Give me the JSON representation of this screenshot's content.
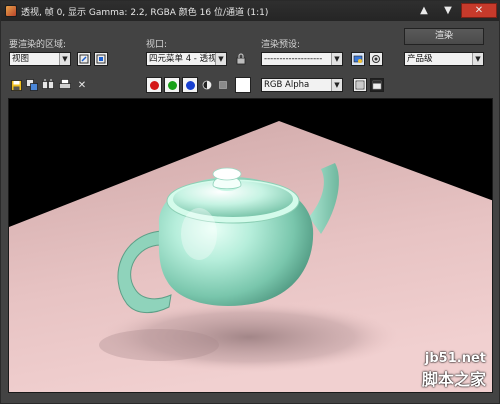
{
  "window": {
    "title": "透视, 帧 0, 显示 Gamma: 2.2, RGBA 颜色 16 位/通道 (1:1)",
    "controls": {
      "minimize": "▲",
      "restore": "▼",
      "close": "✕"
    }
  },
  "render_area": {
    "label": "要渲染的区域:",
    "value": "视图"
  },
  "viewport_select": {
    "label": "视口:",
    "value": "四元菜单 4 - 透视"
  },
  "render_preset": {
    "label": "渲染预设:",
    "value": "-------------------"
  },
  "render_button": {
    "label": "渲染"
  },
  "quality_select": {
    "value": "产品级"
  },
  "channel_select": {
    "value": "RGB Alpha"
  },
  "colors": {
    "red": "#d41818",
    "green": "#18a018",
    "blue": "#1840d0",
    "swatch": "#ffffff",
    "accent_close": "#c63a2b"
  },
  "icons": [
    "save-icon",
    "copy-icon",
    "clone-icon",
    "print-icon",
    "clear-icon",
    "lock-icon",
    "render-setup-icon",
    "environment-icon",
    "monochrome-icon",
    "display-mode-icon"
  ],
  "watermark": {
    "url": "jb51.net",
    "name": "脚本之家"
  }
}
